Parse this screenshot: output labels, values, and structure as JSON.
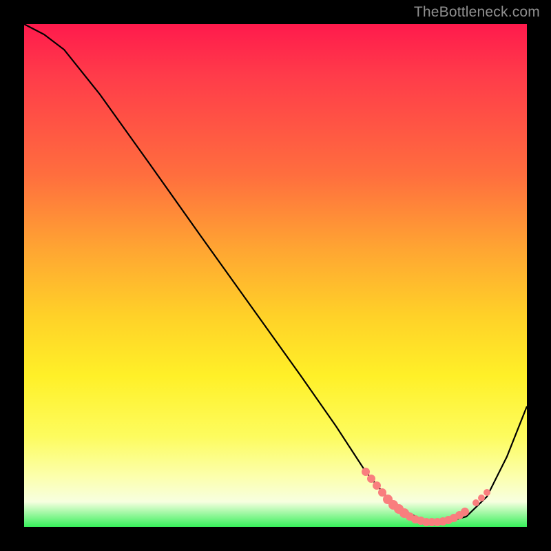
{
  "watermark": "TheBottleneck.com",
  "colors": {
    "background": "#000000",
    "curve_stroke": "#000000",
    "dot_salmon": "#f97e7e",
    "gradient_top": "#ff1a4c",
    "gradient_bottom": "#37f05a"
  },
  "chart_data": {
    "type": "line",
    "title": "",
    "xlabel": "",
    "ylabel": "",
    "xlim": [
      0,
      100
    ],
    "ylim": [
      0,
      100
    ],
    "grid": false,
    "legend": false,
    "series": [
      {
        "name": "bottleneck-curve",
        "x": [
          0,
          4,
          8,
          15,
          25,
          35,
          45,
          55,
          62,
          68,
          72,
          76,
          80,
          84,
          88,
          92,
          96,
          100
        ],
        "y": [
          100,
          98,
          95,
          86,
          72,
          58,
          44,
          30,
          20,
          11,
          6,
          3,
          1,
          1,
          2,
          6,
          14,
          24
        ]
      }
    ],
    "annotations": {
      "dotted_segment_x_range": [
        68,
        92
      ],
      "note": "Salmon dotted overlay along the valley of the curve, approx x 68–92, y 1–11."
    }
  }
}
